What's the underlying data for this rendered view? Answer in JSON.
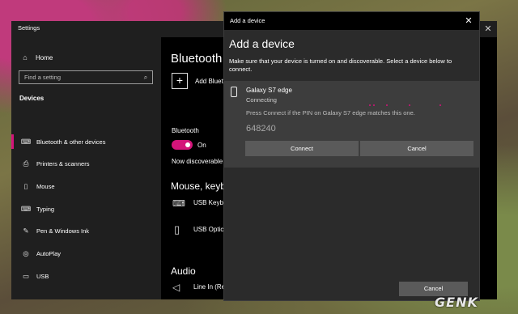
{
  "settings": {
    "title": "Settings",
    "close_glyph": "✕",
    "home_label": "Home",
    "search_placeholder": "Find a setting",
    "section_heading": "Devices",
    "nav": [
      {
        "label": "Bluetooth & other devices",
        "icon": "bluetooth-devices-icon",
        "glyph": "⌨",
        "active": true
      },
      {
        "label": "Printers & scanners",
        "icon": "printer-icon",
        "glyph": "⎙",
        "active": false
      },
      {
        "label": "Mouse",
        "icon": "mouse-icon",
        "glyph": "▯",
        "active": false
      },
      {
        "label": "Typing",
        "icon": "keyboard-icon",
        "glyph": "⌨",
        "active": false
      },
      {
        "label": "Pen & Windows Ink",
        "icon": "pen-icon",
        "glyph": "✎",
        "active": false
      },
      {
        "label": "AutoPlay",
        "icon": "autoplay-icon",
        "glyph": "◎",
        "active": false
      },
      {
        "label": "USB",
        "icon": "usb-icon",
        "glyph": "▭",
        "active": false
      }
    ],
    "content": {
      "page_title_partial": "Bluetooth",
      "add_bluetooth_partial": "Add Bluet",
      "bluetooth_label": "Bluetooth",
      "bluetooth_state": "On",
      "now_discoverable_partial": "Now discoverable",
      "mouse_keyboard_partial": "Mouse, keyb",
      "usb_keyboard_partial": "USB Keybo",
      "usb_optical_partial": "USB Optic",
      "audio_heading": "Audio",
      "line_in_partial": "Line In (Re"
    }
  },
  "dialog": {
    "titlebar": "Add a device",
    "close_glyph": "✕",
    "heading": "Add a device",
    "description": "Make sure that your device is turned on and discoverable. Select a device below to connect.",
    "device": {
      "name": "Galaxy S7 edge",
      "status": "Connecting",
      "pin_hint": "Press Connect if the PIN on Galaxy S7 edge matches this one.",
      "pin": "648240",
      "connect_label": "Connect",
      "cancel_label": "Cancel"
    },
    "cancel_label": "Cancel"
  },
  "watermark": "GENK",
  "colors": {
    "accent": "#d4147a",
    "dialog_bg": "#2b2b2b",
    "card_bg": "#3d3d3d",
    "button_bg": "#5a5a5a"
  }
}
